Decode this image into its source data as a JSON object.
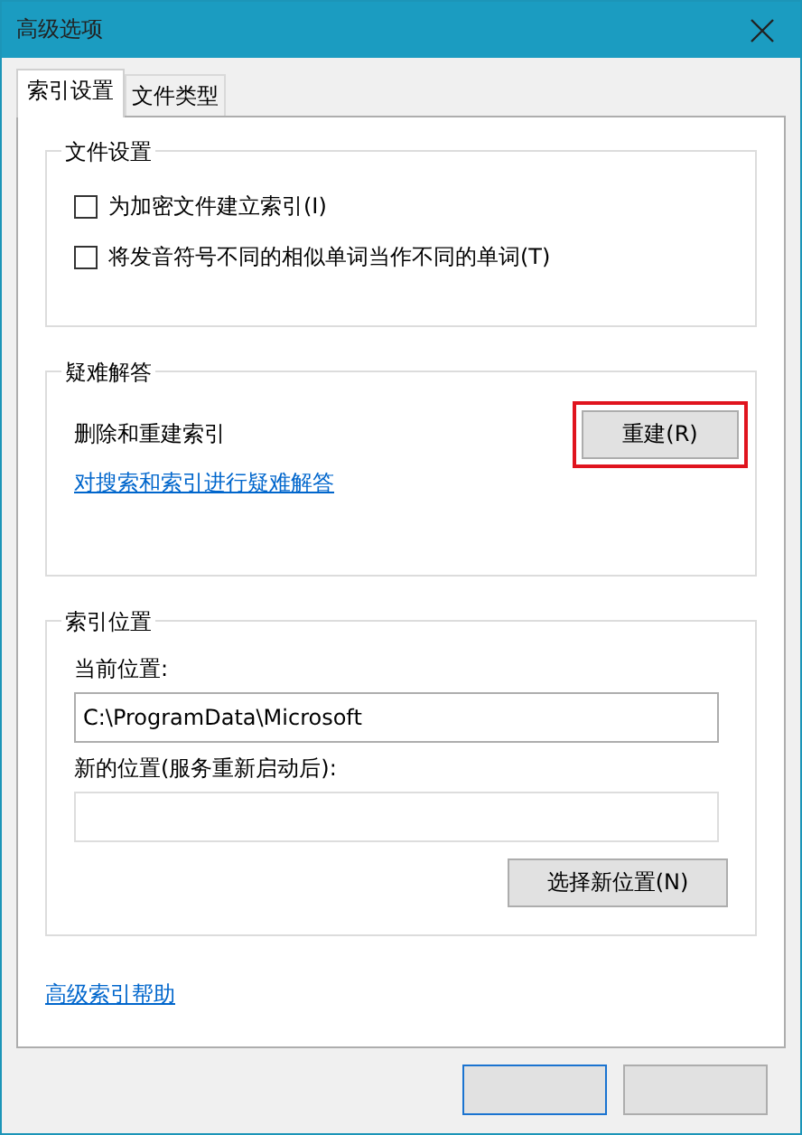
{
  "window": {
    "title": "高级选项"
  },
  "tabs": [
    {
      "label": "索引设置",
      "selected": true
    },
    {
      "label": "文件类型",
      "selected": false
    }
  ],
  "file_settings": {
    "title": "文件设置",
    "options": [
      {
        "label": "为加密文件建立索引(I)",
        "checked": false
      },
      {
        "label": "将发音符号不同的相似单词当作不同的单词(T)",
        "checked": false
      }
    ]
  },
  "troubleshooting": {
    "title": "疑难解答",
    "label": "删除和重建索引",
    "button": {
      "label": "重建(R)",
      "highlighted": true
    },
    "link": "对搜索和索引进行疑难解答"
  },
  "index_location": {
    "title": "索引位置",
    "current_label": "当前位置:",
    "current_value": "C:\\ProgramData\\Microsoft",
    "new_label": "新的位置(服务重新启动后):",
    "button": "选择新位置(N)"
  },
  "help_link": "高级索引帮助"
}
